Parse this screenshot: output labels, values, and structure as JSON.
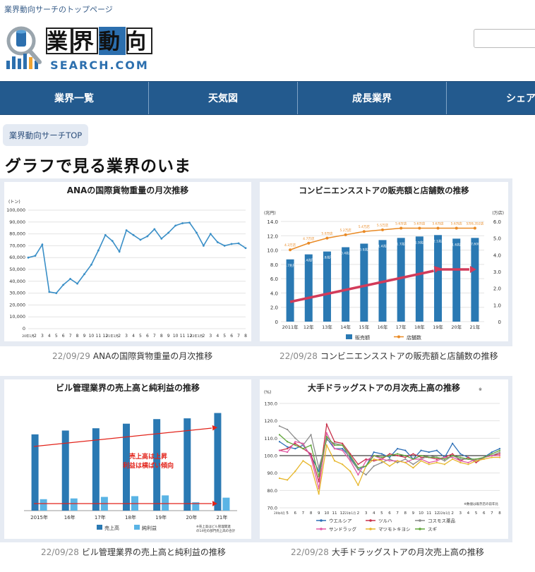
{
  "header": {
    "tagline": "業界動向サーチのトップページ",
    "logo_main": "業界動向",
    "logo_sub": "SEARCH.COM"
  },
  "nav": {
    "items": [
      "業界一覧",
      "天気図",
      "成長業界",
      "シェア"
    ]
  },
  "breadcrumb": "業界動向サーチTOP",
  "page_title": "グラフで見る業界のいま",
  "colors": {
    "nav": "#235a8e",
    "accent_blue": "#2a79b3",
    "light_blue": "#5ab4e5",
    "orange": "#e98a25",
    "red_arrow": "#d23b5a"
  },
  "captions": [
    {
      "date": "22/09/29",
      "text": "ANAの国際貨物重量の月次推移"
    },
    {
      "date": "22/09/28",
      "text": "コンビニエンスストアの販売額と店舗数の推移"
    },
    {
      "date": "22/09/28",
      "text": "ビル管理業界の売上高と純利益の推移"
    },
    {
      "date": "22/09/28",
      "text": "大手ドラッグストアの月次売上高の推移"
    }
  ],
  "chart_data": [
    {
      "type": "line",
      "title": "ANAの国際貨物重量の月次推移",
      "ylabel": "(トン)",
      "ylim": [
        0,
        100000
      ],
      "yticks": [
        "0",
        "10,000",
        "20,000",
        "30,000",
        "40,000",
        "50,000",
        "60,000",
        "70,000",
        "80,000",
        "90,000",
        "100,000"
      ],
      "xticks": [
        "20年1月",
        "2",
        "3",
        "4",
        "5",
        "6",
        "7",
        "8",
        "9",
        "10",
        "11",
        "12",
        "21年1月",
        "2",
        "3",
        "4",
        "5",
        "6",
        "7",
        "8",
        "9",
        "10",
        "11",
        "12",
        "22年1月",
        "2",
        "3",
        "4",
        "5",
        "6",
        "7",
        "8"
      ],
      "values": [
        60000,
        61500,
        71000,
        31000,
        30000,
        37000,
        42000,
        38000,
        46000,
        54000,
        66000,
        79000,
        74000,
        65000,
        83000,
        79000,
        75000,
        78000,
        84000,
        76000,
        81000,
        87000,
        89000,
        89500,
        81000,
        70000,
        80000,
        73000,
        70000,
        71500,
        72000,
        68000
      ],
      "grid": true,
      "color": "#3a8fc7"
    },
    {
      "type": "bar",
      "title": "コンビニエンスストアの販売額と店舗数の推移",
      "ylabel_left": "(兆円)",
      "ylabel_right": "(万店)",
      "ylim": [
        0,
        14
      ],
      "y2lim": [
        0,
        6
      ],
      "yticks": [
        "0",
        "2.0",
        "4.0",
        "6.0",
        "8.0",
        "10.0",
        "12.0",
        "14.0"
      ],
      "y2ticks": [
        "0",
        "1.0",
        "2.0",
        "3.0",
        "4.0",
        "5.0",
        "6.0"
      ],
      "categories": [
        "2011年",
        "12年",
        "13年",
        "14年",
        "15年",
        "16年",
        "17年",
        "18年",
        "19年",
        "20年",
        "21年"
      ],
      "series": [
        {
          "name": "販売額",
          "values": [
            8.7,
            9.4,
            9.8,
            10.4,
            10.9,
            11.4,
            11.7,
            11.9,
            12.1,
            11.6,
            11.7
          ]
        },
        {
          "name": "店舗数",
          "values": [
            4.3,
            4.7,
            5.0,
            5.2,
            5.4,
            5.5,
            5.6,
            5.6,
            5.6,
            5.6,
            5.6
          ]
        }
      ],
      "bar_labels": [
        "8.7兆円",
        "9.4兆円",
        "9.8兆円",
        "10.4兆円",
        "10.9兆円",
        "11.4兆円",
        "11.7兆円",
        "11.9兆円",
        "12.1兆円",
        "11.6兆円",
        "11兆7,600億円"
      ],
      "store_labels": [
        "4.3万店",
        "4.7万店",
        "5.0万店",
        "5.2万店",
        "5.4万店",
        "5.5万店",
        "5.6万店",
        "5.6万店",
        "5.6万店",
        "5.6万店",
        "5万8,352店"
      ],
      "legend": [
        "販売額",
        "店舗数"
      ],
      "grid": true
    },
    {
      "type": "bar",
      "title": "ビル管理業界の売上高と純利益の推移",
      "categories": [
        "2015年",
        "16年",
        "17年",
        "18年",
        "19年",
        "20年",
        "21年"
      ],
      "series": [
        {
          "name": "売上高",
          "values": [
            100,
            105,
            108,
            114,
            120,
            121,
            128
          ]
        },
        {
          "name": "純利益",
          "values": [
            15,
            16,
            18,
            19,
            20,
            11,
            17
          ]
        }
      ],
      "ylim": [
        0,
        135
      ],
      "annotation": [
        "売上高は上昇",
        "利益は横ばい傾向"
      ],
      "note": [
        "※売上高はビル管理関連",
        "の14社の部門売上高の合計"
      ],
      "legend": [
        "売上高",
        "純利益"
      ],
      "grid": false
    },
    {
      "type": "line",
      "title": "大手ドラッグストアの月次売上高の推移",
      "title_suffix": "※",
      "ylabel": "(%)",
      "ylim": [
        70,
        130
      ],
      "yticks": [
        "70.0",
        "80.0",
        "90.0",
        "100.0",
        "110.0",
        "120.0",
        "130.0"
      ],
      "xticks": [
        "20年4月",
        "5",
        "6",
        "7",
        "8",
        "9",
        "10",
        "11",
        "12",
        "21年1月",
        "2",
        "3",
        "4",
        "5",
        "6",
        "7",
        "8",
        "9",
        "10",
        "11",
        "12",
        "22年1月",
        "2",
        "3",
        "4",
        "5",
        "6",
        "7",
        "8"
      ],
      "note": "※数値は既存店の前年比",
      "series": [
        {
          "name": "ウエルシア",
          "values": [
            108,
            105,
            104,
            106,
            100,
            91,
            110,
            104,
            104,
            99,
            92,
            94,
            102,
            101,
            99,
            104,
            103,
            98,
            103,
            102,
            103,
            99,
            107,
            101,
            99,
            97,
            99,
            102,
            104
          ]
        },
        {
          "name": "ツルハ",
          "values": [
            103,
            104,
            107,
            104,
            101,
            85,
            118,
            108,
            107,
            101,
            95,
            98,
            97,
            98,
            101,
            100,
            99,
            101,
            99,
            99,
            98,
            99,
            101,
            97,
            99,
            96,
            99,
            100,
            101
          ]
        },
        {
          "name": "コスモス薬品",
          "values": [
            117,
            115,
            110,
            106,
            112,
            93,
            109,
            107,
            106,
            98,
            92,
            89,
            94,
            96,
            98,
            96,
            98,
            95,
            98,
            100,
            99,
            97,
            100,
            98,
            98,
            97,
            99,
            100,
            102
          ]
        },
        {
          "name": "サンドラッグ",
          "values": [
            103,
            102,
            108,
            107,
            99,
            81,
            113,
            104,
            103,
            97,
            89,
            97,
            100,
            98,
            97,
            97,
            96,
            98,
            98,
            96,
            97,
            99,
            99,
            97,
            96,
            98,
            99,
            100,
            100
          ]
        },
        {
          "name": "マツモトキヨシ",
          "values": [
            87,
            86,
            91,
            97,
            94,
            78,
            106,
            97,
            95,
            91,
            83,
            94,
            98,
            97,
            94,
            97,
            96,
            93,
            97,
            95,
            96,
            95,
            98,
            96,
            95,
            97,
            98,
            99,
            99
          ]
        },
        {
          "name": "スギ",
          "values": [
            112,
            108,
            106,
            104,
            106,
            88,
            111,
            106,
            106,
            100,
            93,
            94,
            100,
            99,
            100,
            101,
            100,
            98,
            100,
            99,
            99,
            98,
            100,
            99,
            98,
            98,
            99,
            101,
            103
          ]
        }
      ],
      "colors": [
        "#2d6fb7",
        "#c8324b",
        "#8c8c8c",
        "#e25aa7",
        "#e7b72c",
        "#62a73b"
      ],
      "grid": true
    }
  ]
}
